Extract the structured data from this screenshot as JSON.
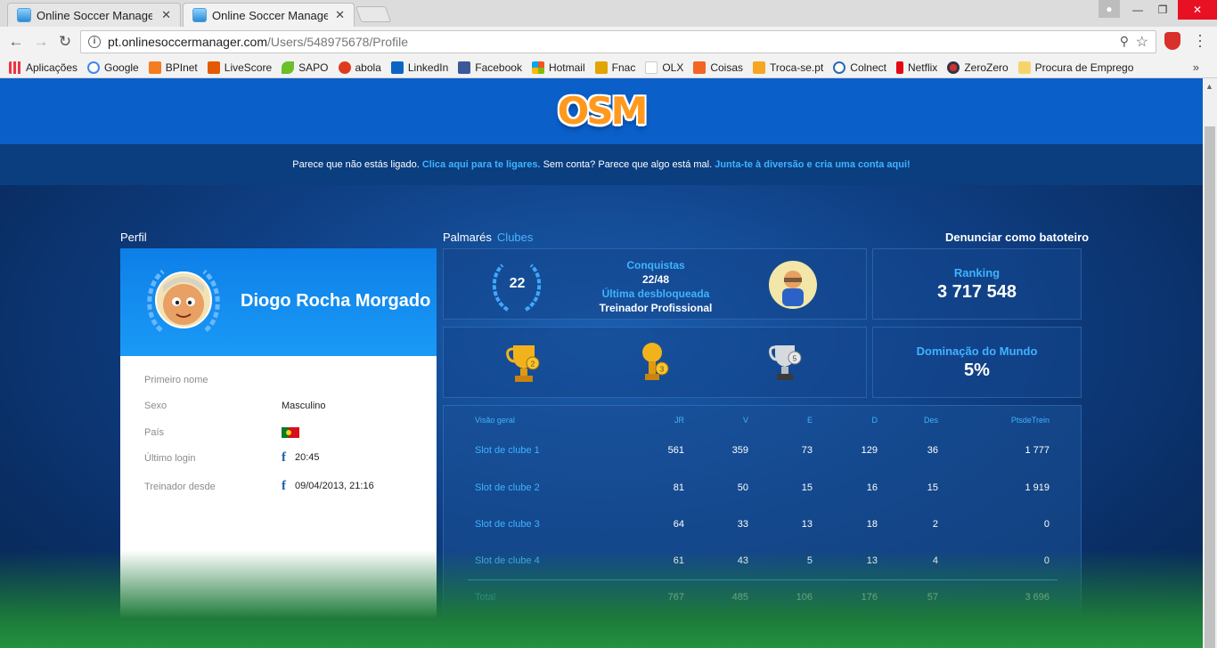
{
  "browser": {
    "tabs": [
      {
        "title": "Online Soccer Manager (",
        "close": "✕"
      },
      {
        "title": "Online Soccer Manager (",
        "close": "✕"
      }
    ],
    "url_host": "pt.onlinesoccermanager.com",
    "url_path": "/Users/548975678/Profile",
    "bookmarks": [
      "Aplicações",
      "Google",
      "BPInet",
      "LiveScore",
      "SAPO",
      "abola",
      "LinkedIn",
      "Facebook",
      "Hotmail",
      "Fnac",
      "OLX",
      "Coisas",
      "Troca-se.pt",
      "Colnect",
      "Netflix",
      "ZeroZero",
      "Procura de Emprego"
    ],
    "bookmarks_more": "»"
  },
  "site": {
    "logo": "OSM",
    "login_prefix": "Parece que não estás ligado.",
    "login_link": "Clica aqui para te ligares.",
    "login_middle": "Sem conta? Parece que algo está mal.",
    "signup_link": "Junta-te à diversão e cria uma conta aqui!"
  },
  "profile": {
    "section_title": "Perfil",
    "name": "Diogo Rocha Morgado",
    "fields": {
      "first_name_label": "Primeiro nome",
      "sex_label": "Sexo",
      "sex_value": "Masculino",
      "country_label": "País",
      "last_login_label": "Último login",
      "last_login_value": "20:45",
      "since_label": "Treinador desde",
      "since_value": "09/04/2013, 21:16"
    }
  },
  "honours": {
    "tab_palmares": "Palmarés",
    "tab_clubes": "Clubes",
    "report_cheater": "Denunciar como batoteiro",
    "achievements_count": "22",
    "achievements_label": "Conquistas",
    "achievements_value": "22/48",
    "last_unlocked_label": "Última desbloqueada",
    "last_unlocked_value": "Treinador Profissional",
    "ranking_label": "Ranking",
    "ranking_value": "3 717 548",
    "domination_label": "Dominação do Mundo",
    "domination_value": "5%",
    "trophies": [
      {
        "icon": "gold-cup-icon",
        "badge": "2"
      },
      {
        "icon": "gold-ball-trophy-icon",
        "badge": "3"
      },
      {
        "icon": "silver-cup-icon",
        "badge": "5"
      }
    ]
  },
  "table": {
    "headers": [
      "Visão geral",
      "JR",
      "V",
      "E",
      "D",
      "Des",
      "PtsdeTrein"
    ],
    "rows": [
      {
        "label": "Slot de clube 1",
        "values": [
          "561",
          "359",
          "73",
          "129",
          "36",
          "1 777"
        ]
      },
      {
        "label": "Slot de clube 2",
        "values": [
          "81",
          "50",
          "15",
          "16",
          "15",
          "1 919"
        ]
      },
      {
        "label": "Slot de clube 3",
        "values": [
          "64",
          "33",
          "13",
          "18",
          "2",
          "0"
        ]
      },
      {
        "label": "Slot de clube 4",
        "values": [
          "61",
          "43",
          "5",
          "13",
          "4",
          "0"
        ]
      }
    ],
    "total": {
      "label": "Total",
      "values": [
        "767",
        "485",
        "106",
        "176",
        "57",
        "3 696"
      ]
    }
  },
  "colors": {
    "accent": "#3fb3ff",
    "header": "#0a5fc9",
    "logo": "#ff9a1f"
  }
}
